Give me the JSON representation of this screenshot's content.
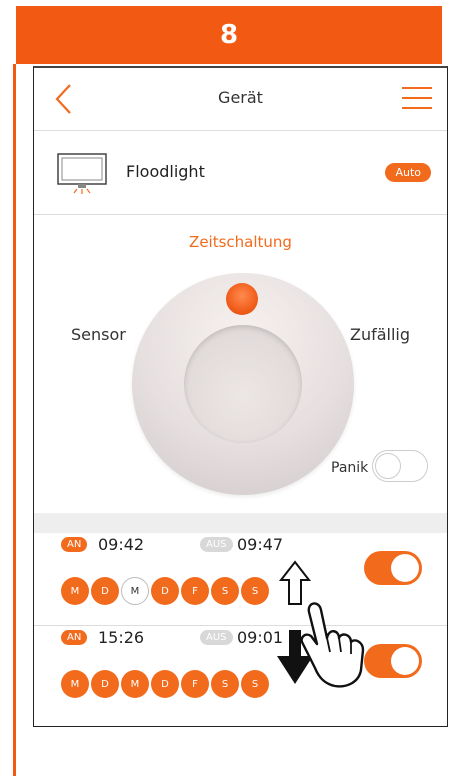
{
  "step_number": "8",
  "header": {
    "title": "Gerät",
    "back_icon": "chevron-left-icon",
    "menu_icon": "hamburger-menu-icon"
  },
  "device": {
    "name": "Floodlight",
    "badge": "Auto",
    "icon": "floodlight-icon"
  },
  "mode": {
    "title": "Zeitschaltung",
    "left": "Sensor",
    "right": "Zufällig",
    "panik_label": "Panik"
  },
  "schedules": [
    {
      "on_tag": "AN",
      "on_time": "09:42",
      "off_tag": "AUS",
      "off_time": "09:47",
      "days": [
        {
          "label": "M",
          "active": true
        },
        {
          "label": "D",
          "active": true
        },
        {
          "label": "M",
          "active": false
        },
        {
          "label": "D",
          "active": true
        },
        {
          "label": "F",
          "active": true
        },
        {
          "label": "S",
          "active": true
        },
        {
          "label": "S",
          "active": true
        }
      ],
      "enabled": true
    },
    {
      "on_tag": "AN",
      "on_time": "15:26",
      "off_tag": "AUS",
      "off_time": "09:01",
      "days": [
        {
          "label": "M",
          "active": true
        },
        {
          "label": "D",
          "active": true
        },
        {
          "label": "M",
          "active": true
        },
        {
          "label": "D",
          "active": true
        },
        {
          "label": "F",
          "active": true
        },
        {
          "label": "S",
          "active": true
        },
        {
          "label": "S",
          "active": true
        }
      ],
      "enabled": true
    }
  ],
  "colors": {
    "accent": "#f26a1b",
    "banner": "#f25a14",
    "inactive": "#d8d8d8"
  },
  "gesture_icon": "swipe-hand-icon"
}
